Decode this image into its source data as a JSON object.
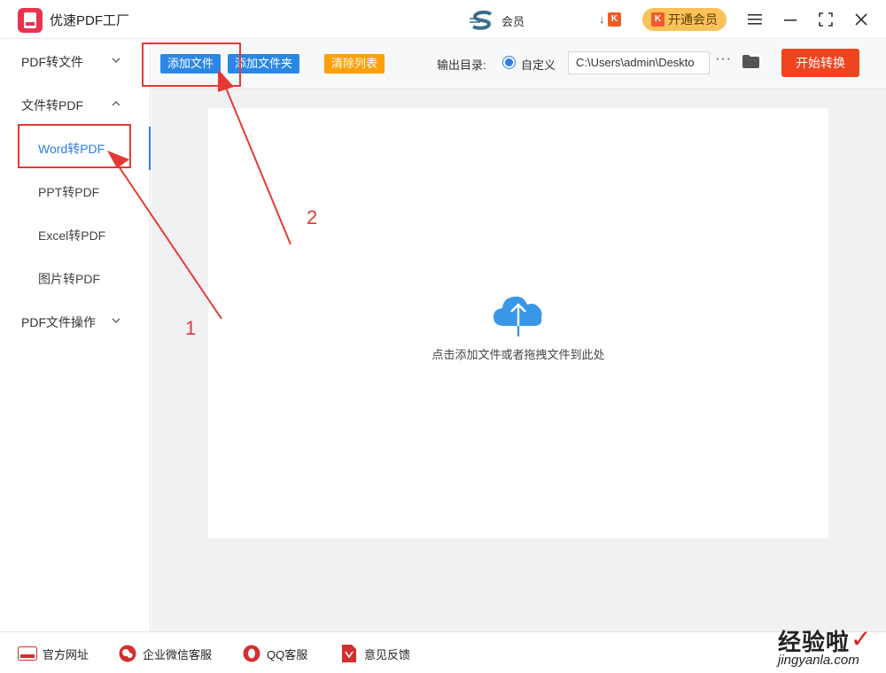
{
  "app": {
    "title": "优速PDF工厂"
  },
  "promo": {
    "text": "会员"
  },
  "header": {
    "vip_label": "开通会员",
    "k_letter": "K",
    "download_glyph": "↓"
  },
  "sidebar": {
    "groups": [
      {
        "label": "PDF转文件"
      },
      {
        "label": "文件转PDF"
      },
      {
        "label": "PDF文件操作"
      }
    ],
    "subitems": [
      {
        "label": "Word转PDF",
        "active": true
      },
      {
        "label": "PPT转PDF"
      },
      {
        "label": "Excel转PDF"
      },
      {
        "label": "图片转PDF"
      }
    ]
  },
  "toolbar": {
    "add_file": "添加文件",
    "add_folder": "添加文件夹",
    "clear_list": "清除列表",
    "output_label": "输出目录:",
    "radio_label": "自定义",
    "path_value": "C:\\Users\\admin\\Deskto",
    "more": "···",
    "start": "开始转换"
  },
  "dropzone": {
    "hint": "点击添加文件或者拖拽文件到此处"
  },
  "footer": {
    "items": [
      {
        "label": "官方网址",
        "icon": "globe-icon"
      },
      {
        "label": "企业微信客服",
        "icon": "wechat-icon"
      },
      {
        "label": "QQ客服",
        "icon": "qq-icon"
      },
      {
        "label": "意见反馈",
        "icon": "feedback-icon"
      }
    ]
  },
  "watermark": {
    "text": "经验啦",
    "url": "jingyanla.com"
  },
  "annotations": {
    "label_1": "1",
    "label_2": "2"
  },
  "colors": {
    "accent": "#2b7de9",
    "start": "#f0441f",
    "orange": "#ff9f0a",
    "annotation": "#e53935",
    "vip": "#fbc259"
  }
}
